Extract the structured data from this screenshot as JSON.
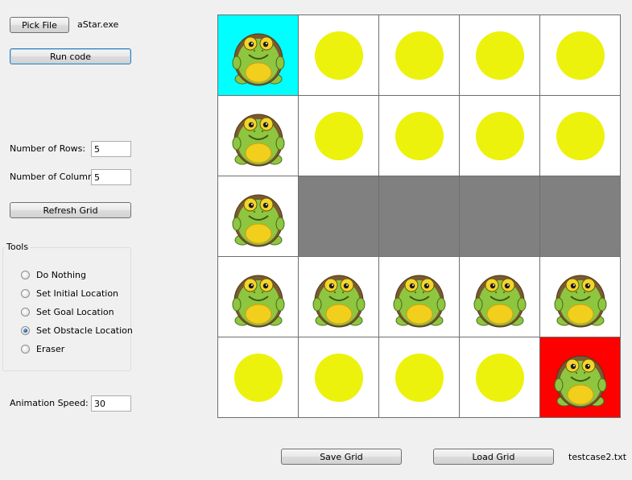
{
  "file": {
    "pick_button": "Pick File",
    "file_name": "aStar.exe",
    "run_button": "Run code"
  },
  "rows": {
    "label": "Number of Rows:",
    "value": "5"
  },
  "columns": {
    "label": "Number of Columns:",
    "value": "5"
  },
  "refresh_button": "Refresh Grid",
  "tools": {
    "title": "Tools",
    "options": [
      {
        "label": "Do Nothing",
        "checked": false
      },
      {
        "label": "Set Initial Location",
        "checked": false
      },
      {
        "label": "Set Goal Location",
        "checked": false
      },
      {
        "label": "Set Obstacle Location",
        "checked": true
      },
      {
        "label": "Eraser",
        "checked": false
      }
    ]
  },
  "animation_speed": {
    "label": "Animation Speed:",
    "value": "30"
  },
  "bottom": {
    "save_button": "Save Grid",
    "load_button": "Load Grid",
    "loaded_file": "testcase2.txt"
  },
  "grid": {
    "rows": 5,
    "cols": 5,
    "legend": {
      "S": "start-cell",
      "G": "goal-cell",
      "T": "turtle-path",
      "O": "obstacle",
      "D": "open-dot"
    },
    "cells": [
      [
        "S",
        "D",
        "D",
        "D",
        "D"
      ],
      [
        "T",
        "D",
        "D",
        "D",
        "D"
      ],
      [
        "T",
        "O",
        "O",
        "O",
        "O"
      ],
      [
        "T",
        "T",
        "T",
        "T",
        "T"
      ],
      [
        "D",
        "D",
        "D",
        "D",
        "G"
      ]
    ],
    "colors": {
      "start": "#00ffff",
      "goal": "#ff0000",
      "obstacle": "#808080",
      "dot": "#ecf20c",
      "open": "#ffffff"
    }
  }
}
